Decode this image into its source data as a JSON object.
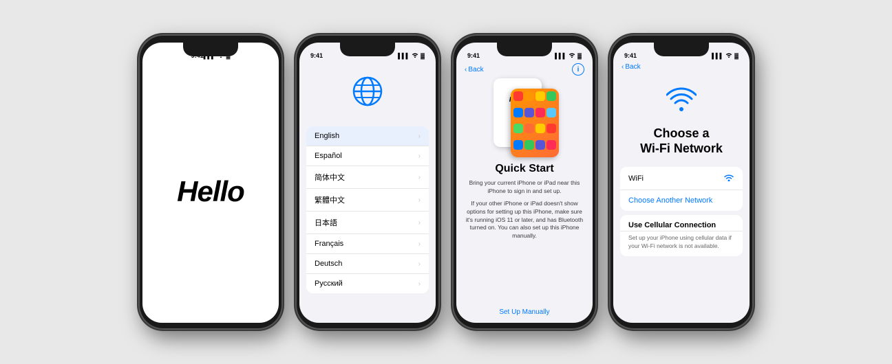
{
  "phones": [
    {
      "id": "phone1",
      "type": "hello",
      "statusBar": {
        "time": "9:41",
        "signal": "●●●",
        "wifi": true,
        "battery": "■"
      },
      "content": {
        "hello": "Hello"
      }
    },
    {
      "id": "phone2",
      "type": "language",
      "statusBar": {
        "time": "9:41",
        "signal": "●●●",
        "wifi": true,
        "battery": "■"
      },
      "languages": [
        {
          "name": "English",
          "selected": true
        },
        {
          "name": "Español",
          "selected": false
        },
        {
          "name": "简体中文",
          "selected": false
        },
        {
          "name": "繁體中文",
          "selected": false
        },
        {
          "name": "日本語",
          "selected": false
        },
        {
          "name": "Français",
          "selected": false
        },
        {
          "name": "Deutsch",
          "selected": false
        },
        {
          "name": "Русский",
          "selected": false
        }
      ]
    },
    {
      "id": "phone3",
      "type": "quickstart",
      "statusBar": {
        "time": "9:41",
        "signal": "●●●",
        "wifi": true,
        "battery": "■"
      },
      "nav": {
        "back": "Back",
        "info": "i"
      },
      "content": {
        "title": "Quick Start",
        "body1": "Bring your current iPhone or iPad near this iPhone to sign in and set up.",
        "body2": "If your other iPhone or iPad doesn't show options for setting up this iPhone, make sure it's running iOS 11 or later, and has Bluetooth turned on. You can also set up this iPhone manually.",
        "setupManually": "Set Up Manually"
      }
    },
    {
      "id": "phone4",
      "type": "wifi",
      "statusBar": {
        "time": "9:41",
        "signal": "●●●",
        "wifi": true,
        "battery": "■"
      },
      "nav": {
        "back": "Back"
      },
      "content": {
        "title": "Choose a\nWi-Fi Network",
        "wifiName": "WiFi",
        "chooseAnother": "Choose Another Network",
        "cellularTitle": "Use Cellular Connection",
        "cellularDesc": "Set up your iPhone using cellular data if your Wi-Fi network is not available."
      }
    }
  ]
}
